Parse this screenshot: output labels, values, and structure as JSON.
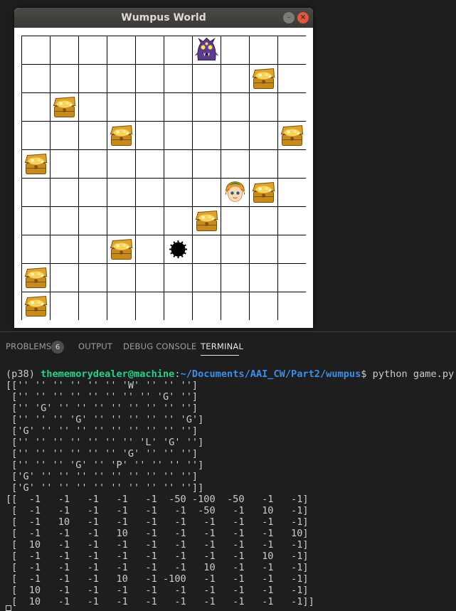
{
  "window": {
    "title": "Wumpus World",
    "minimize_glyph": "–",
    "close_glyph": "×"
  },
  "board": {
    "rows": 10,
    "cols": 10,
    "cells": [
      [
        {
          "r": 0,
          "c": 6,
          "type": "wumpus"
        }
      ],
      [
        {
          "r": 1,
          "c": 8,
          "type": "gold"
        }
      ],
      [
        {
          "r": 2,
          "c": 1,
          "type": "gold"
        }
      ],
      [
        {
          "r": 3,
          "c": 3,
          "type": "gold"
        },
        {
          "r": 3,
          "c": 9,
          "type": "gold"
        }
      ],
      [
        {
          "r": 4,
          "c": 0,
          "type": "gold"
        }
      ],
      [
        {
          "r": 5,
          "c": 7,
          "type": "player"
        },
        {
          "r": 5,
          "c": 8,
          "type": "gold"
        }
      ],
      [
        {
          "r": 6,
          "c": 6,
          "type": "gold"
        }
      ],
      [
        {
          "r": 7,
          "c": 3,
          "type": "gold"
        },
        {
          "r": 7,
          "c": 5,
          "type": "pit"
        }
      ],
      [
        {
          "r": 8,
          "c": 0,
          "type": "gold"
        }
      ],
      [
        {
          "r": 9,
          "c": 0,
          "type": "gold"
        }
      ]
    ]
  },
  "panel": {
    "tabs": {
      "problems": "PROBLEMS",
      "problems_count": "6",
      "output": "OUTPUT",
      "debug": "DEBUG CONSOLE",
      "terminal": "TERMINAL"
    }
  },
  "terminal": {
    "env": "(p38) ",
    "user": "thememorydealer@machine",
    "sep": ":",
    "path": "~/Documents/AAI_CW/Part2/wumpus",
    "command": "$ python game.py",
    "lines": [
      "[['' '' '' '' '' '' 'W' '' '' '']",
      " ['' '' '' '' '' '' '' '' 'G' '']",
      " ['' 'G' '' '' '' '' '' '' '' '']",
      " ['' '' '' 'G' '' '' '' '' '' 'G']",
      " ['G' '' '' '' '' '' '' '' '' '']",
      " ['' '' '' '' '' '' '' 'L' 'G' '']",
      " ['' '' '' '' '' '' 'G' '' '' '']",
      " ['' '' '' 'G' '' 'P' '' '' '' '']",
      " ['G' '' '' '' '' '' '' '' '' '']",
      " ['G' '' '' '' '' '' '' '' '' '']]",
      "[[  -1   -1   -1   -1   -1  -50 -100  -50   -1   -1]",
      " [  -1   -1   -1   -1   -1   -1  -50   -1   10   -1]",
      " [  -1   10   -1   -1   -1   -1   -1   -1   -1   -1]",
      " [  -1   -1   -1   10   -1   -1   -1   -1   -1   10]",
      " [  10   -1   -1   -1   -1   -1   -1   -1   -1   -1]",
      " [  -1   -1   -1   -1   -1   -1   -1   -1   10   -1]",
      " [  -1   -1   -1   -1   -1   -1   10   -1   -1   -1]",
      " [  -1   -1   -1   10   -1 -100   -1   -1   -1   -1]",
      " [  10   -1   -1   -1   -1   -1   -1   -1   -1   -1]",
      " [  10   -1   -1   -1   -1   -1   -1   -1   -1   -1]]"
    ]
  }
}
